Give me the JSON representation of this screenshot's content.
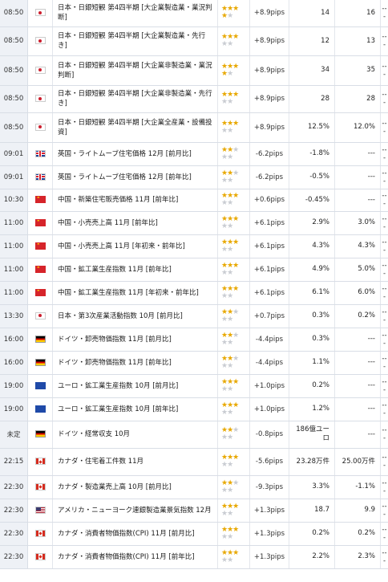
{
  "rows": [
    {
      "time": "08:50",
      "country": "jp",
      "flag": "japan-flag-icon",
      "indicator": "日本・日銀短観 第4四半期 [大企業製造業・業況判断]",
      "stars": [
        true,
        true,
        true,
        true,
        false
      ],
      "pips": "+8.9pips",
      "prev": "14",
      "forecast": "16",
      "result": "---",
      "h": 33
    },
    {
      "time": "08:50",
      "country": "jp",
      "flag": "japan-flag-icon",
      "indicator": "日本・日銀短観 第4四半期 [大企業製造業・先行き]",
      "stars": [
        true,
        true,
        true,
        false,
        false
      ],
      "pips": "+8.9pips",
      "prev": "12",
      "forecast": "13",
      "result": "---",
      "h": 36
    },
    {
      "time": "08:50",
      "country": "jp",
      "flag": "japan-flag-icon",
      "indicator": "日本・日銀短観 第4四半期 [大企業非製造業・業況判断]",
      "stars": [
        true,
        true,
        true,
        true,
        false
      ],
      "pips": "+8.9pips",
      "prev": "34",
      "forecast": "35",
      "result": "---",
      "h": 37
    },
    {
      "time": "08:50",
      "country": "jp",
      "flag": "japan-flag-icon",
      "indicator": "日本・日銀短観 第4四半期 [大企業非製造業・先行き]",
      "stars": [
        true,
        true,
        true,
        false,
        false
      ],
      "pips": "+8.9pips",
      "prev": "28",
      "forecast": "28",
      "result": "---",
      "h": 34
    },
    {
      "time": "08:50",
      "country": "jp",
      "flag": "japan-flag-icon",
      "indicator": "日本・日銀短観 第4四半期 [大企業全産業・設備投資]",
      "stars": [
        true,
        true,
        true,
        false,
        false
      ],
      "pips": "+8.9pips",
      "prev": "12.5%",
      "forecast": "12.0%",
      "result": "---",
      "h": 37
    },
    {
      "time": "09:01",
      "country": "gb",
      "flag": "uk-flag-icon",
      "indicator": "英国・ライトムーブ住宅価格 12月 [前月比]",
      "stars": [
        true,
        true,
        false,
        false,
        false
      ],
      "pips": "-6.2pips",
      "prev": "-1.8%",
      "forecast": "---",
      "result": "---",
      "h": 29
    },
    {
      "time": "09:01",
      "country": "gb",
      "flag": "uk-flag-icon",
      "indicator": "英国・ライトムーブ住宅価格 12月 [前年比]",
      "stars": [
        true,
        true,
        false,
        false,
        false
      ],
      "pips": "-6.2pips",
      "prev": "-0.5%",
      "forecast": "---",
      "result": "---",
      "h": 29
    },
    {
      "time": "10:30",
      "country": "cn",
      "flag": "china-flag-icon",
      "indicator": "中国・新築住宅販売価格 11月 [前年比]",
      "stars": [
        true,
        true,
        true,
        false,
        false
      ],
      "pips": "+0.6pips",
      "prev": "-0.45%",
      "forecast": "---",
      "result": "---",
      "h": 28
    },
    {
      "time": "11:00",
      "country": "cn",
      "flag": "china-flag-icon",
      "indicator": "中国・小売売上高 11月 [前年比]",
      "stars": [
        true,
        true,
        true,
        false,
        false
      ],
      "pips": "+6.1pips",
      "prev": "2.9%",
      "forecast": "3.0%",
      "result": "---",
      "h": 29
    },
    {
      "time": "11:00",
      "country": "cn",
      "flag": "china-flag-icon",
      "indicator": "中国・小売売上高 11月 [年初来・前年比]",
      "stars": [
        true,
        true,
        true,
        false,
        false
      ],
      "pips": "+6.1pips",
      "prev": "4.3%",
      "forecast": "4.3%",
      "result": "---",
      "h": 29
    },
    {
      "time": "11:00",
      "country": "cn",
      "flag": "china-flag-icon",
      "indicator": "中国・鉱工業生産指数 11月 [前年比]",
      "stars": [
        true,
        true,
        true,
        false,
        false
      ],
      "pips": "+6.1pips",
      "prev": "4.9%",
      "forecast": "5.0%",
      "result": "---",
      "h": 29
    },
    {
      "time": "11:00",
      "country": "cn",
      "flag": "china-flag-icon",
      "indicator": "中国・鉱工業生産指数 11月 [年初来・前年比]",
      "stars": [
        true,
        true,
        true,
        false,
        false
      ],
      "pips": "+6.1pips",
      "prev": "6.1%",
      "forecast": "6.0%",
      "result": "---",
      "h": 29
    },
    {
      "time": "13:30",
      "country": "jp",
      "flag": "japan-flag-icon",
      "indicator": "日本・第3次産業活動指数 10月 [前月比]",
      "stars": [
        true,
        true,
        false,
        false,
        false
      ],
      "pips": "+0.7pips",
      "prev": "0.3%",
      "forecast": "0.2%",
      "result": "---",
      "h": 29
    },
    {
      "time": "16:00",
      "country": "de",
      "flag": "germany-flag-icon",
      "indicator": "ドイツ・卸売物価指数 11月 [前月比]",
      "stars": [
        true,
        true,
        false,
        false,
        false
      ],
      "pips": "-4.4pips",
      "prev": "0.3%",
      "forecast": "---",
      "result": "---",
      "h": 29
    },
    {
      "time": "16:00",
      "country": "de",
      "flag": "germany-flag-icon",
      "indicator": "ドイツ・卸売物価指数 11月 [前年比]",
      "stars": [
        true,
        true,
        false,
        false,
        false
      ],
      "pips": "-4.4pips",
      "prev": "1.1%",
      "forecast": "---",
      "result": "---",
      "h": 29
    },
    {
      "time": "19:00",
      "country": "eu",
      "flag": "eu-flag-icon",
      "indicator": "ユーロ・鉱工業生産指数 10月 [前月比]",
      "stars": [
        true,
        true,
        true,
        false,
        false
      ],
      "pips": "+1.0pips",
      "prev": "0.2%",
      "forecast": "---",
      "result": "---",
      "h": 29
    },
    {
      "time": "19:00",
      "country": "eu",
      "flag": "eu-flag-icon",
      "indicator": "ユーロ・鉱工業生産指数 10月 [前年比]",
      "stars": [
        true,
        true,
        true,
        false,
        false
      ],
      "pips": "+1.0pips",
      "prev": "1.2%",
      "forecast": "---",
      "result": "---",
      "h": 29
    },
    {
      "time": "未定",
      "country": "de",
      "flag": "germany-flag-icon",
      "indicator": "ドイツ・経常収支 10月",
      "stars": [
        true,
        true,
        false,
        false,
        false
      ],
      "pips": "-0.8pips",
      "prev": "186億ユーロ",
      "forecast": "---",
      "result": "---",
      "h": 34
    },
    {
      "time": "22:15",
      "country": "ca",
      "flag": "canada-flag-icon",
      "indicator": "カナダ・住宅着工件数 11月",
      "stars": [
        true,
        true,
        true,
        false,
        false
      ],
      "pips": "-5.6pips",
      "prev": "23.28万件",
      "forecast": "25.00万件",
      "result": "---",
      "h": 34
    },
    {
      "time": "22:30",
      "country": "ca",
      "flag": "canada-flag-icon",
      "indicator": "カナダ・製造業売上高 10月 [前月比]",
      "stars": [
        true,
        true,
        false,
        false,
        false
      ],
      "pips": "-9.3pips",
      "prev": "3.3%",
      "forecast": "-1.1%",
      "result": "---",
      "h": 29
    },
    {
      "time": "22:30",
      "country": "us",
      "flag": "usa-flag-icon",
      "indicator": "アメリカ・ニューヨーク連銀製造業景気指数 12月",
      "stars": [
        true,
        true,
        true,
        false,
        false
      ],
      "pips": "+1.3pips",
      "prev": "18.7",
      "forecast": "9.9",
      "result": "---",
      "h": 29
    },
    {
      "time": "22:30",
      "country": "ca",
      "flag": "canada-flag-icon",
      "indicator": "カナダ・消費者物価指数(CPI) 11月 [前月比]",
      "stars": [
        true,
        true,
        true,
        false,
        false
      ],
      "pips": "+1.3pips",
      "prev": "0.2%",
      "forecast": "0.2%",
      "result": "---",
      "h": 29
    },
    {
      "time": "22:30",
      "country": "ca",
      "flag": "canada-flag-icon",
      "indicator": "カナダ・消費者物価指数(CPI) 11月 [前年比]",
      "stars": [
        true,
        true,
        true,
        false,
        false
      ],
      "pips": "+1.3pips",
      "prev": "2.2%",
      "forecast": "2.3%",
      "result": "---",
      "h": 29
    }
  ]
}
